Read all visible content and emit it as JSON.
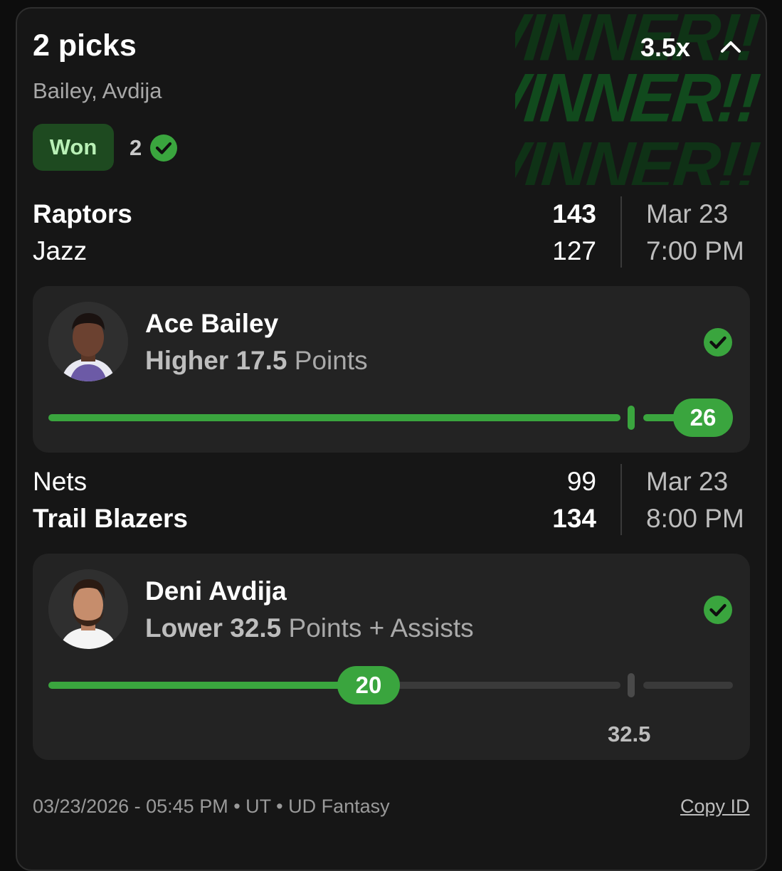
{
  "header": {
    "title": "2 picks",
    "subtitle": "Bailey, Avdija",
    "multiplier": "3.5x",
    "watermark": "WINNER!!"
  },
  "status": {
    "badge": "Won",
    "count": "2"
  },
  "games": [
    {
      "team1": "Raptors",
      "score1": "143",
      "team2": "Jazz",
      "score2": "127",
      "date": "Mar 23",
      "time": "7:00 PM"
    },
    {
      "team1": "Nets",
      "score1": "99",
      "team2": "Trail Blazers",
      "score2": "134",
      "date": "Mar 23",
      "time": "8:00 PM"
    }
  ],
  "picks": [
    {
      "player": "Ace Bailey",
      "direction": "Higher",
      "line": "17.5",
      "stat": "Points",
      "result": "26"
    },
    {
      "player": "Deni Avdija",
      "direction": "Lower",
      "line": "32.5",
      "stat": "Points + Assists",
      "result": "20"
    }
  ],
  "footer": {
    "meta": "03/23/2026 - 05:45 PM • UT • UD Fantasy",
    "copy": "Copy ID"
  },
  "colors": {
    "accent": "#3aa53e",
    "badge_bg": "#1e4a20",
    "card_bg": "#161616",
    "pick_bg": "#232323"
  }
}
